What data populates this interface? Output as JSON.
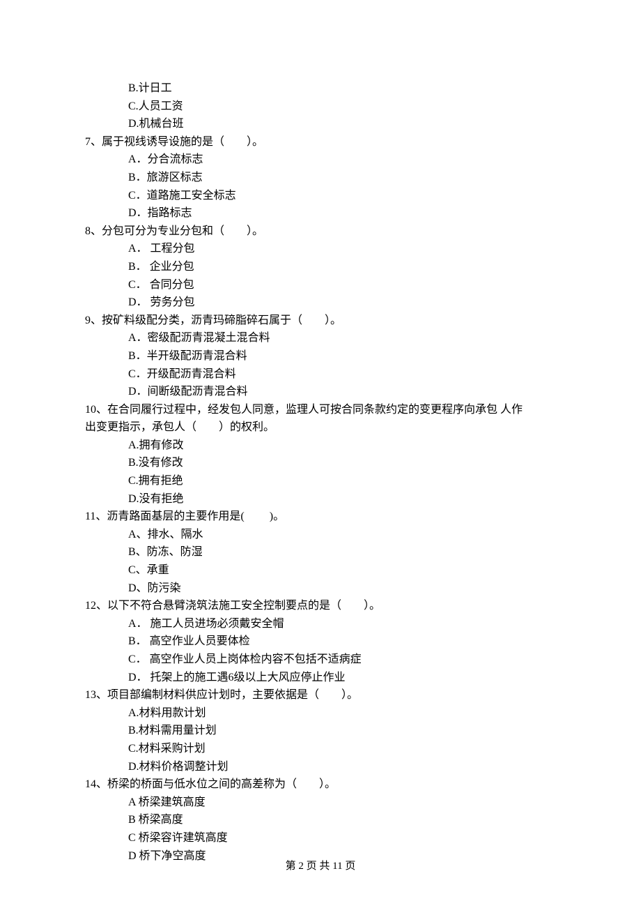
{
  "prev_options": {
    "b": "B.计日工",
    "c": "C.人员工资",
    "d": "D.机械台班"
  },
  "q7": {
    "stem": "7、属于视线诱导设施的是（　　）。",
    "a": "A．分合流标志",
    "b": "B．旅游区标志",
    "c": "C．道路施工安全标志",
    "d": "D．指路标志"
  },
  "q8": {
    "stem": "8、分包可分为专业分包和（　　）。",
    "a": "A． 工程分包",
    "b": "B． 企业分包",
    "c": "C． 合同分包",
    "d": "D． 劳务分包"
  },
  "q9": {
    "stem": "9、按矿料级配分类，沥青玛碲脂碎石属于（　　）。",
    "a": "A．密级配沥青混凝土混合料",
    "b": "B．半开级配沥青混合料",
    "c": "C．开级配沥青混合料",
    "d": "D．间断级配沥青混合料"
  },
  "q10": {
    "stem_line1": "10、在合同履行过程中，经发包人同意，监理人可按合同条款约定的变更程序向承包 人作",
    "stem_line2": "出变更指示，承包人（　　）的权利。",
    "a": "A.拥有修改",
    "b": "B.没有修改",
    "c": "C.拥有拒绝",
    "d": "D.没有拒绝"
  },
  "q11": {
    "stem": "11、沥青路面基层的主要作用是(　　 )。",
    "a": "A、排水、隔水",
    "b": "B、防冻、防湿",
    "c": "C、承重",
    "d": "D、防污染"
  },
  "q12": {
    "stem": "12、以下不符合悬臂浇筑法施工安全控制要点的是（　　）。",
    "a": "A． 施工人员进场必须戴安全帽",
    "b": "B． 高空作业人员要体检",
    "c": "C． 高空作业人员上岗体检内容不包括不适病症",
    "d": "D． 托架上的施工遇6级以上大风应停止作业"
  },
  "q13": {
    "stem": "13、项目部编制材料供应计划时，主要依据是（　　）。",
    "a": "A.材料用款计划",
    "b": "B.材料需用量计划",
    "c": "C.材料采购计划",
    "d": "D.材料价格调整计划"
  },
  "q14": {
    "stem": "14、桥梁的桥面与低水位之间的高差称为（　　）。",
    "a": "A 桥梁建筑高度",
    "b": "B 桥梁高度",
    "c": "C 桥梁容许建筑高度",
    "d": "D 桥下净空高度"
  },
  "footer": "第 2 页 共 11 页"
}
